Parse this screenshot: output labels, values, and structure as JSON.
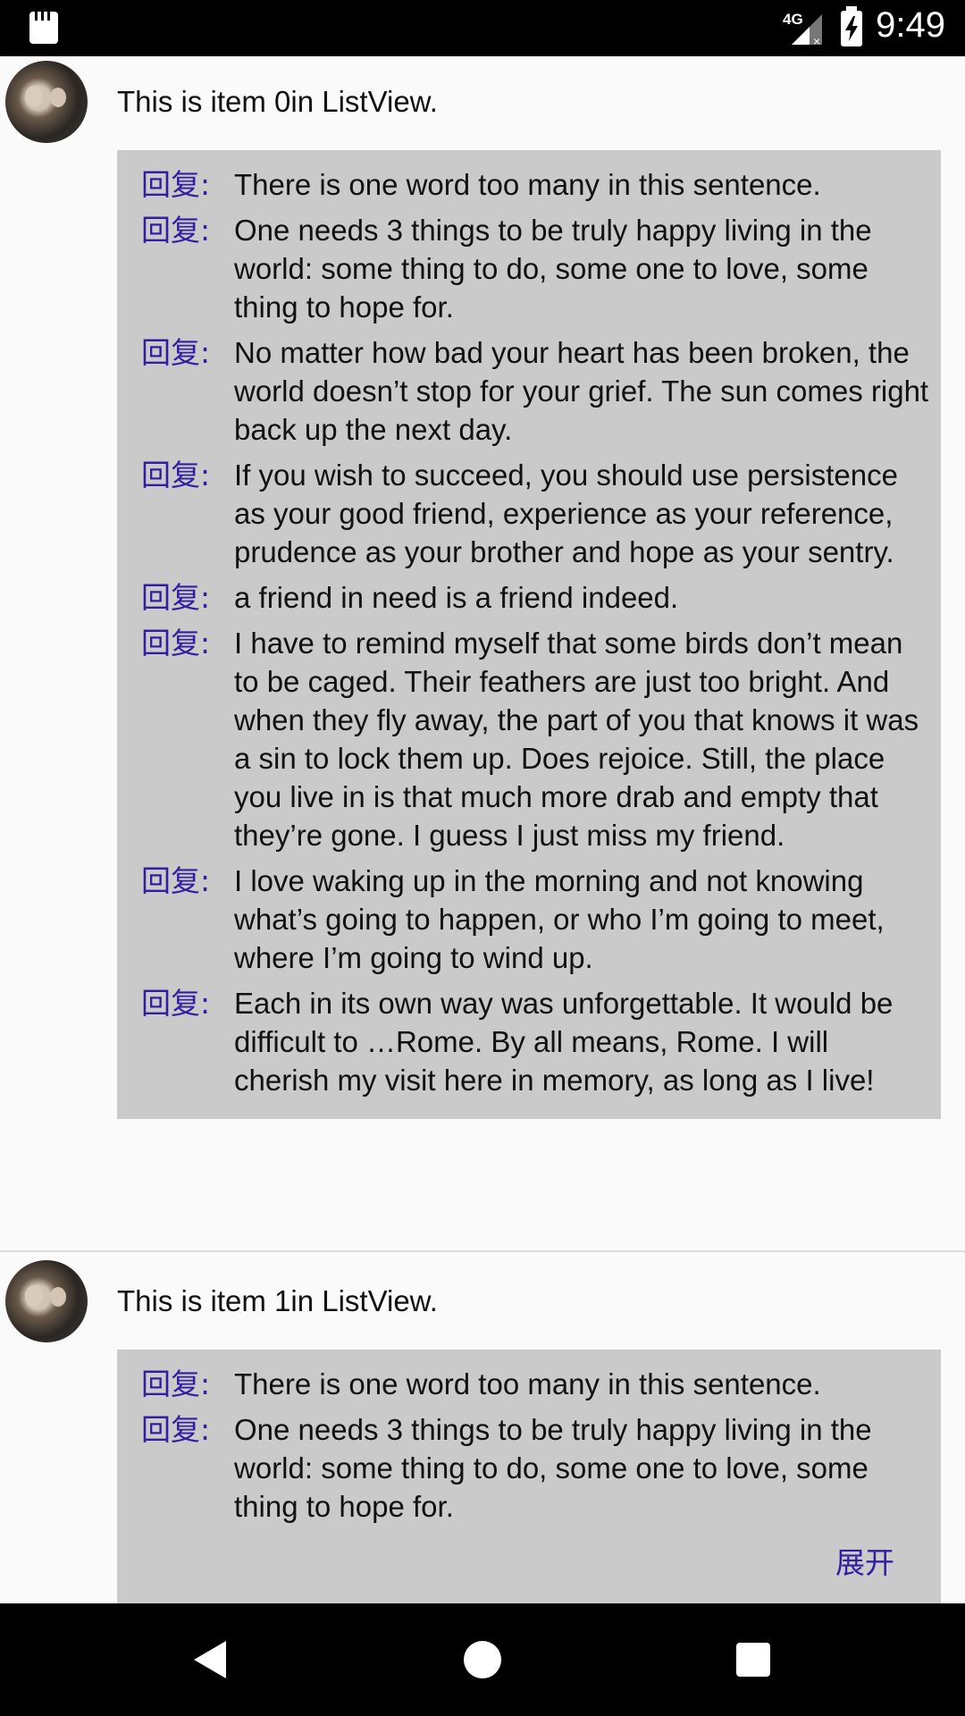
{
  "status_bar": {
    "time": "9:49",
    "network": "4G",
    "icons": [
      "sd-card-icon",
      "signal-icon",
      "battery-charging-icon"
    ]
  },
  "list": {
    "items": [
      {
        "title": "This is item 0in ListView.",
        "reply_prefix": "回复:",
        "replies": [
          "There is one word too many in this sentence.",
          "One needs 3 things to be truly happy living in the world: some thing to do, some one to love, some thing to hope for.",
          "No matter how bad your heart has been broken, the world doesn’t stop for your grief. The sun comes right back up the next day.",
          "If you wish to succeed, you should use persistence as your good friend, experience as your reference, prudence as your brother and hope as your sentry.",
          "a friend in need is a friend indeed.",
          " I have to remind myself that some birds don’t mean to be caged. Their feathers are just too bright. And when they fly away, the part of you that knows it was a sin to lock them up. Does rejoice. Still, the place you live in is that much more drab and empty that they’re gone. I guess I just miss my friend.",
          "I love waking up in the morning and not knowing what’s going to happen, or who I’m going to meet, where I’m going to wind up.",
          "Each in its own way was unforgettable. It would be difficult to …Rome. By all means, Rome. I will cherish my visit here in memory, as long as I live!"
        ]
      },
      {
        "title": "This is item 1in ListView.",
        "reply_prefix": "回复:",
        "replies": [
          "There is one word too many in this sentence.",
          "One needs 3 things to be truly happy living in the world: some thing to do, some one to love, some thing to hope for."
        ],
        "expand_label": "展开"
      }
    ]
  },
  "nav_bar": {
    "icons": [
      "back-icon",
      "home-icon",
      "recents-icon"
    ]
  },
  "colors": {
    "reply_prefix": "#3020a0",
    "reply_background": "#cacaca",
    "page_background": "#fafafa"
  }
}
